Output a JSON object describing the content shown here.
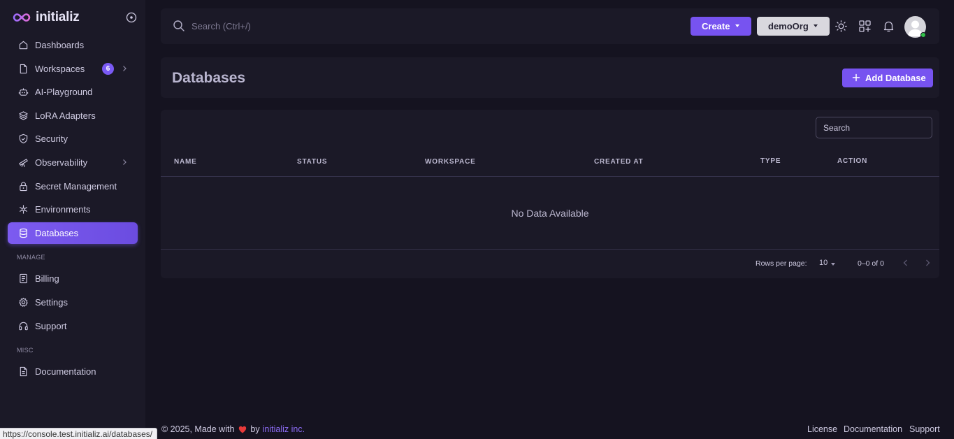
{
  "brand": {
    "name": "initializ"
  },
  "sidebar": {
    "items": [
      {
        "label": "Dashboards",
        "icon": "home-icon"
      },
      {
        "label": "Workspaces",
        "icon": "file-icon",
        "badge": "6",
        "has_submenu": true
      },
      {
        "label": "AI-Playground",
        "icon": "robot-icon"
      },
      {
        "label": "LoRA Adapters",
        "icon": "layers-icon"
      },
      {
        "label": "Security",
        "icon": "shield-icon"
      },
      {
        "label": "Observability",
        "icon": "telescope-icon",
        "has_submenu": true
      },
      {
        "label": "Secret Management",
        "icon": "lock-icon"
      },
      {
        "label": "Environments",
        "icon": "snowflake-icon"
      },
      {
        "label": "Databases",
        "icon": "database-icon",
        "active": true
      }
    ],
    "manage_title": "MANAGE",
    "manage_items": [
      {
        "label": "Billing",
        "icon": "receipt-icon"
      },
      {
        "label": "Settings",
        "icon": "gear-icon"
      },
      {
        "label": "Support",
        "icon": "headphones-icon"
      }
    ],
    "misc_title": "MISC",
    "misc_items": [
      {
        "label": "Documentation",
        "icon": "document-icon"
      }
    ]
  },
  "topbar": {
    "search_placeholder": "Search (Ctrl+/)",
    "create_label": "Create",
    "org_label": "demoOrg",
    "icons": [
      "sun-icon",
      "apps-icon",
      "bell-icon",
      "avatar"
    ]
  },
  "page": {
    "title": "Databases",
    "add_button": "Add Database"
  },
  "table": {
    "search_placeholder": "Search",
    "columns": [
      "NAME",
      "STATUS",
      "WORKSPACE",
      "CREATED AT",
      "TYPE",
      "ACTION"
    ],
    "rows": [],
    "empty_text": "No Data Available",
    "rows_per_page_label": "Rows per page:",
    "rows_per_page": "10",
    "range": "0–0 of 0"
  },
  "footer": {
    "copyright_prefix": "© 2025, Made with",
    "by": "by",
    "company": "initializ inc.",
    "links": [
      "License",
      "Documentation",
      "Support"
    ]
  },
  "status_bar": {
    "url": "https://console.test.initializ.ai/databases/"
  },
  "colors": {
    "accent": "#7753f0",
    "background": "#151320",
    "card": "#1b1927",
    "online": "#32c24a"
  }
}
